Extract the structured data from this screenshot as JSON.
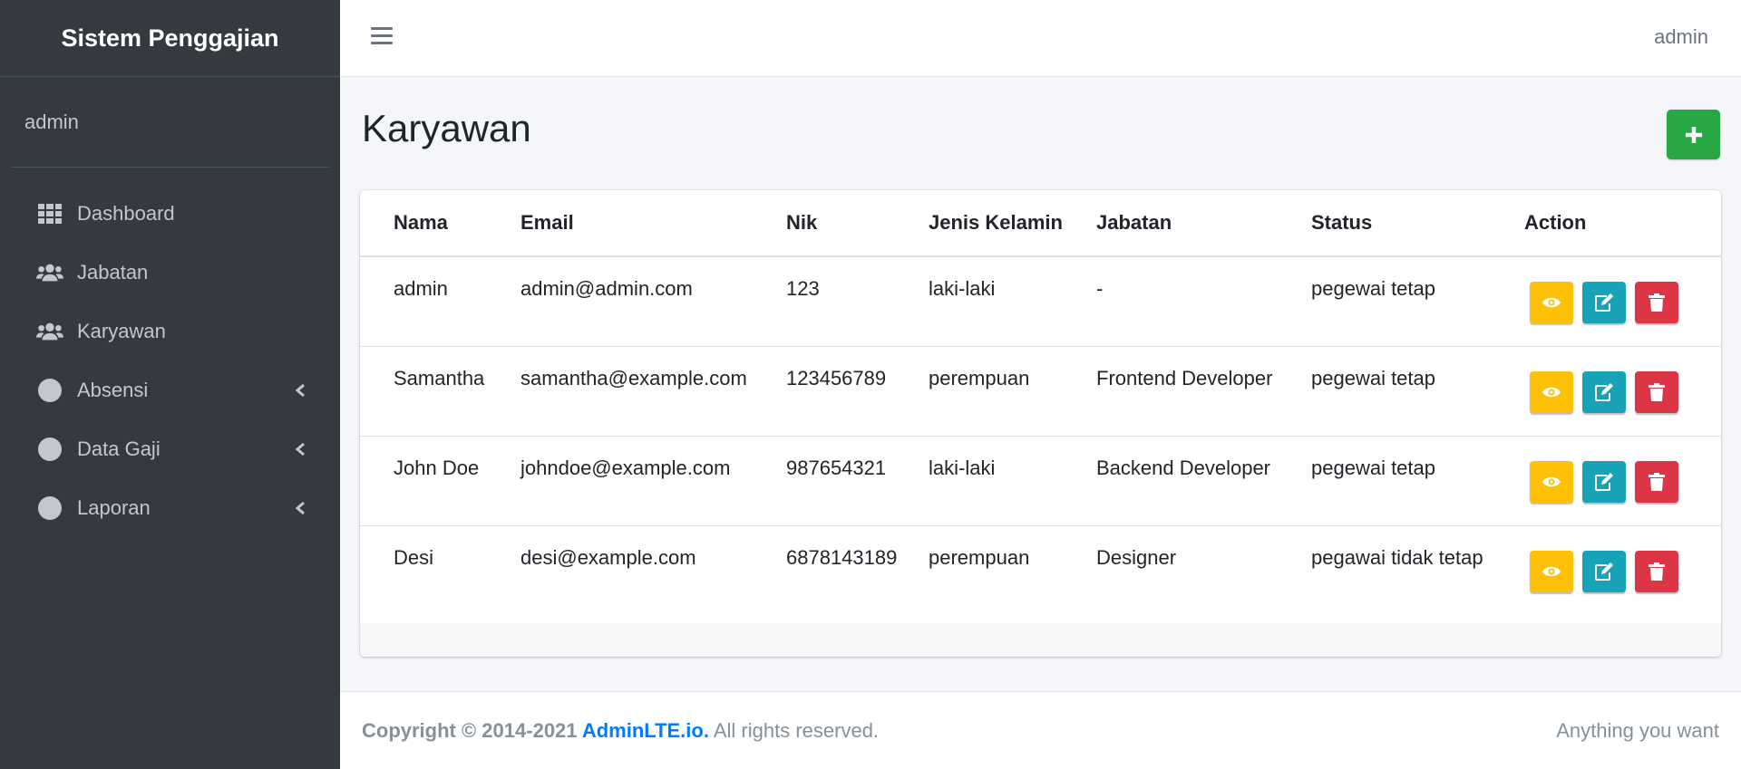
{
  "sidebar": {
    "brand": "Sistem Penggajian",
    "user": "admin",
    "items": [
      {
        "label": "Dashboard",
        "icon": "grid-icon"
      },
      {
        "label": "Jabatan",
        "icon": "users-icon"
      },
      {
        "label": "Karyawan",
        "icon": "users-icon"
      },
      {
        "label": "Absensi",
        "icon": "circle-icon"
      },
      {
        "label": "Data Gaji",
        "icon": "circle-icon"
      },
      {
        "label": "Laporan",
        "icon": "circle-icon"
      }
    ]
  },
  "header": {
    "user": "admin"
  },
  "main": {
    "title": "Karyawan",
    "table": {
      "headers": [
        "Nama",
        "Email",
        "Nik",
        "Jenis Kelamin",
        "Jabatan",
        "Status",
        "Action"
      ],
      "rows": [
        {
          "nama": "admin",
          "email": "admin@admin.com",
          "nik": "123",
          "jk": "laki-laki",
          "jabatan": "-",
          "status": "pegewai tetap"
        },
        {
          "nama": "Samantha",
          "email": "samantha@example.com",
          "nik": "123456789",
          "jk": "perempuan",
          "jabatan": "Frontend Developer",
          "status": "pegewai tetap"
        },
        {
          "nama": "John Doe",
          "email": "johndoe@example.com",
          "nik": "987654321",
          "jk": "laki-laki",
          "jabatan": "Backend Developer",
          "status": "pegewai tetap"
        },
        {
          "nama": "Desi",
          "email": "desi@example.com",
          "nik": "6878143189",
          "jk": "perempuan",
          "jabatan": "Designer",
          "status": "pegawai tidak tetap"
        }
      ]
    }
  },
  "footer": {
    "copyright": "Copyright © 2014-2021 ",
    "link": "AdminLTE.io.",
    "rights": " All rights reserved.",
    "right_text": "Anything you want"
  },
  "colors": {
    "sidebar_bg": "#343a40",
    "add": "#28a745",
    "view": "#ffc107",
    "edit": "#17a2b8",
    "delete": "#dc3545",
    "link": "#007bff"
  }
}
